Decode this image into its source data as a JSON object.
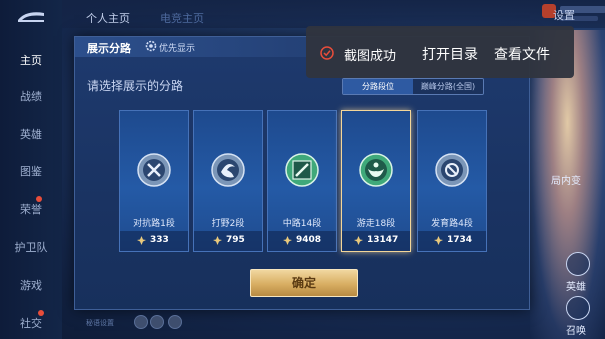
{
  "sidebar": {
    "items": [
      {
        "label": "主页",
        "active": true
      },
      {
        "label": "战绩"
      },
      {
        "label": "英雄"
      },
      {
        "label": "图鉴"
      },
      {
        "label": "荣誉"
      },
      {
        "label": "护卫队"
      },
      {
        "label": "游戏"
      },
      {
        "label": "社交"
      }
    ]
  },
  "topbar": {
    "tabs": [
      "个人主页",
      "电竞主页"
    ],
    "settings_label": "设置"
  },
  "dialog": {
    "title": "展示分路",
    "priority_label": "优先显示",
    "subtitle": "请选择展示的分路",
    "segment": {
      "options": [
        "分路段位",
        "巅峰分路(全国)"
      ],
      "selected": "分路段位"
    },
    "cards": [
      {
        "name": "对抗路1段",
        "score": "333",
        "icon": "crossed-swords-badge-icon"
      },
      {
        "name": "打野2段",
        "score": "795",
        "icon": "swirl-badge-icon"
      },
      {
        "name": "中路14段",
        "score": "9408",
        "icon": "diagonal-staff-badge-icon"
      },
      {
        "name": "游走18段",
        "score": "13147",
        "icon": "hands-badge-icon",
        "selected": true
      },
      {
        "name": "发育路4段",
        "score": "1734",
        "icon": "bow-badge-icon"
      }
    ],
    "confirm_label": "确定"
  },
  "bottom": {
    "hint": "秘语设置"
  },
  "right_panel": {
    "labels": [
      "英雄",
      "召唤",
      "局内变"
    ]
  },
  "toast": {
    "message": "截图成功",
    "open_dir_label": "打开目录",
    "view_file_label": "查看文件"
  },
  "colors": {
    "accent_gold": "#f1d7a0",
    "toast_bg": "#30343e",
    "success_red": "#e84d3a"
  }
}
